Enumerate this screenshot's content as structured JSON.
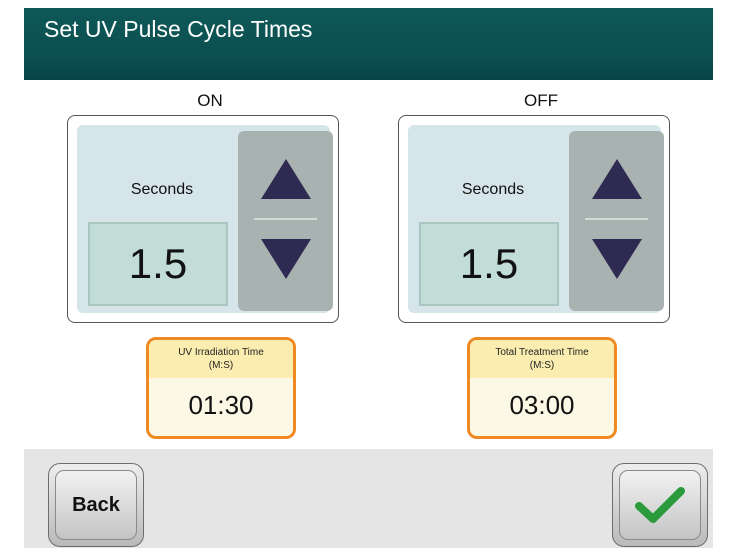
{
  "header": {
    "title": "Set UV Pulse Cycle Times"
  },
  "on_panel": {
    "label": "ON",
    "unit": "Seconds",
    "value": "1.5",
    "up_icon": "triangle-up-icon",
    "down_icon": "triangle-down-icon"
  },
  "off_panel": {
    "label": "OFF",
    "unit": "Seconds",
    "value": "1.5",
    "up_icon": "triangle-up-icon",
    "down_icon": "triangle-down-icon"
  },
  "uv_irradiation": {
    "title": "UV Irradiation Time",
    "unit": "(M:S)",
    "value": "01:30"
  },
  "total_treatment": {
    "title": "Total Treatment Time",
    "unit": "(M:S)",
    "value": "03:00"
  },
  "footer": {
    "back_label": "Back",
    "confirm_icon": "checkmark-icon"
  },
  "colors": {
    "header_bg": "#0b4f50",
    "panel_bg": "#d6e5ea",
    "value_bg": "#c2dcd7",
    "stepper_bg": "#a8b2b0",
    "arrow": "#2e2a52",
    "timer_border": "#ef8a23",
    "timer_head_bg": "#fbedb0",
    "check_green": "#2a9a3a"
  }
}
